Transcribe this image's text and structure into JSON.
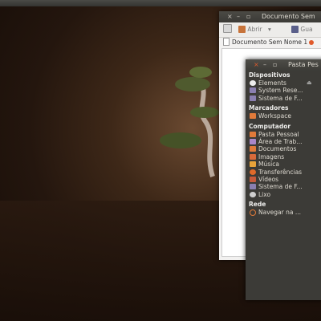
{
  "editor": {
    "title": "Documento Sem",
    "toolbar": {
      "open_label": "Abrir",
      "save_label": "Gua"
    },
    "tab_label": "Documento Sem Nome 1"
  },
  "filemanager": {
    "title": "Pasta Pes",
    "sections": {
      "devices": "Dispositivos",
      "bookmarks": "Marcadores",
      "computer": "Computador",
      "network": "Rede"
    },
    "devices": [
      "Elements",
      "System Rese...",
      "Sistema de F..."
    ],
    "bookmarks": [
      "Workspace"
    ],
    "computer": [
      "Pasta Pessoal",
      "Área de Trab...",
      "Documentos",
      "Imagens",
      "Música",
      "Transferências",
      "Vídeos",
      "Sistema de F...",
      "Lixo"
    ],
    "network": [
      "Navegar na ..."
    ]
  },
  "colors": {
    "accent": "#e05a2b",
    "panel": "#3c3b37"
  }
}
